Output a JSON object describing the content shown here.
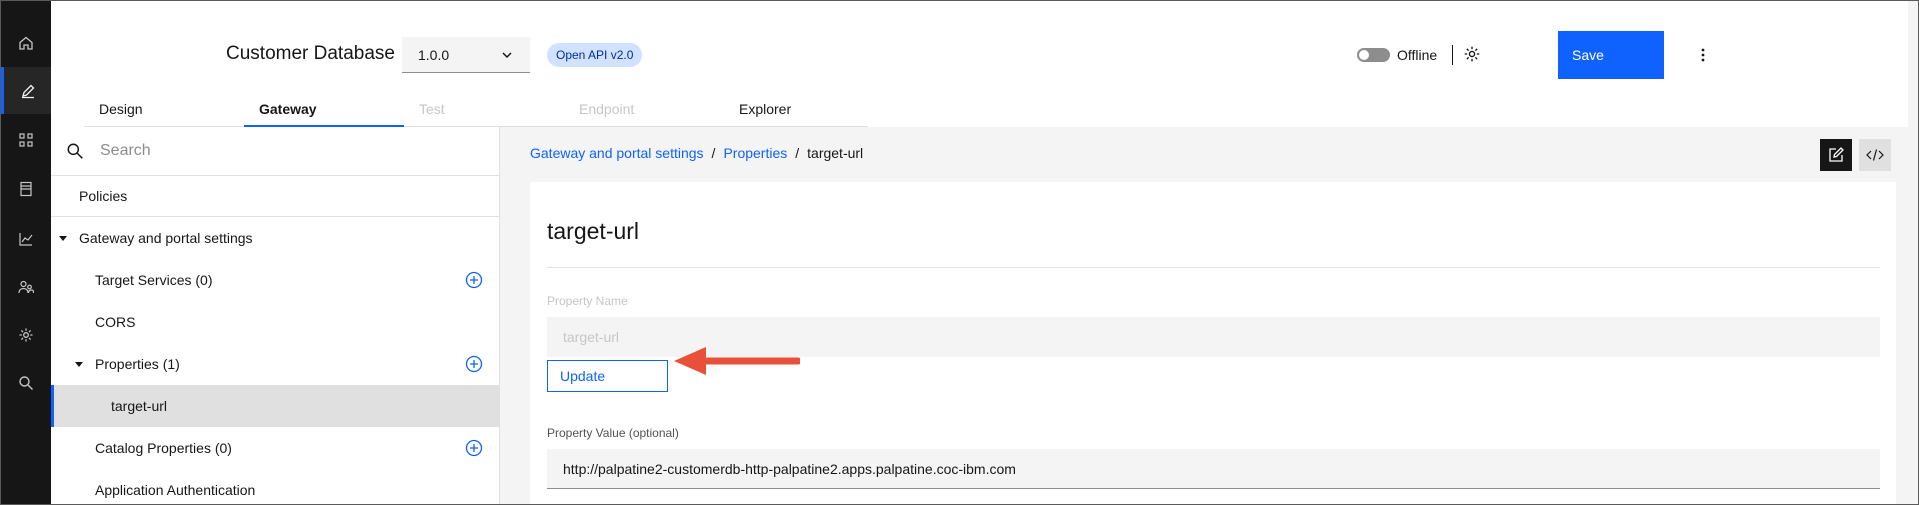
{
  "header": {
    "title": "Customer Database",
    "version": "1.0.0",
    "api_tag": "Open API v2.0",
    "status": "Offline",
    "save_label": "Save"
  },
  "tabs": [
    {
      "label": "Design",
      "state": "normal"
    },
    {
      "label": "Gateway",
      "state": "selected"
    },
    {
      "label": "Test",
      "state": "disabled"
    },
    {
      "label": "Endpoint",
      "state": "disabled"
    },
    {
      "label": "Explorer",
      "state": "normal"
    }
  ],
  "left_rail": {
    "icons": [
      "home-icon",
      "edit-icon",
      "apps-icon",
      "catalog-icon",
      "analytics-icon",
      "users-icon",
      "settings-icon",
      "search-icon"
    ],
    "active": "edit-icon"
  },
  "sidebar": {
    "search_placeholder": "Search",
    "items": [
      {
        "label": "Policies"
      },
      {
        "label": "Gateway and portal settings"
      },
      {
        "label": "Target Services (0)"
      },
      {
        "label": "CORS"
      },
      {
        "label": "Properties (1)"
      },
      {
        "label": "target-url"
      },
      {
        "label": "Catalog Properties (0)"
      },
      {
        "label": "Application Authentication"
      }
    ]
  },
  "breadcrumb": {
    "items": [
      "Gateway and portal settings",
      "Properties"
    ],
    "separator": "/",
    "current": "target-url"
  },
  "editor": {
    "title": "target-url",
    "property_name_label": "Property Name",
    "property_name_value": "target-url",
    "update_label": "Update",
    "property_value_label": "Property Value (optional)",
    "property_value": "http://palpatine2-customerdb-http-palpatine2.apps.palpatine.coc-ibm.com"
  },
  "colors": {
    "accent": "#0f62fe",
    "rail": "#161616",
    "annotation_arrow": "#e8503a"
  }
}
